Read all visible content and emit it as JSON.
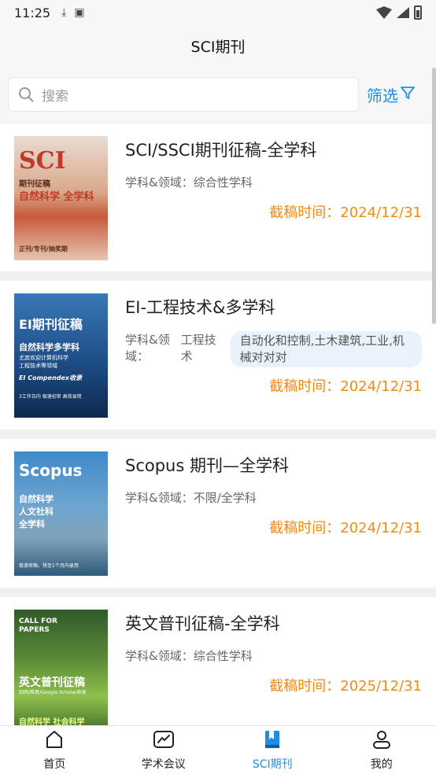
{
  "status": {
    "time": "11:25",
    "download_icon": "download-icon",
    "notification_icon": "a-icon"
  },
  "header": {
    "title": "SCI期刊"
  },
  "search": {
    "placeholder": "搜索",
    "filter_label": "筛选"
  },
  "journals": [
    {
      "title": "SCI/SSCI期刊征稿-全学科",
      "field_label": "学科&领域：",
      "field_value": "综合性学科",
      "tags": [],
      "deadline_label": "截稿时间：",
      "deadline": "2024/12/31",
      "cover_lines": [
        "SCI",
        "期刊征稿",
        "自然科学 全学科",
        "正刊/专刊/抽奖期"
      ]
    },
    {
      "title": "EI-工程技术&多学科",
      "field_label": "学科&领域：",
      "field_value": "工程技术",
      "tags": [
        "自动化和控制,土木建筑,工业,机械对对对"
      ],
      "deadline_label": "截稿时间：",
      "deadline": "2024/12/31",
      "cover_lines": [
        "EI期刊征稿",
        "自然科学多学科",
        "尤其欢迎计算机科学",
        "工程技术等领域",
        "EI Compendex收录",
        "3工作日内 极速初审 高效录用"
      ]
    },
    {
      "title": "Scopus 期刊—全学科",
      "field_label": "学科&领域：",
      "field_value": "不限/全学科",
      "tags": [],
      "deadline_label": "截稿时间：",
      "deadline": "2024/12/31",
      "cover_lines": [
        "Scopus",
        "自然科学",
        "人文社科",
        "全学科",
        "极速审稿，快至1个月内录用"
      ]
    },
    {
      "title": "英文普刊征稿-全学科",
      "field_label": "学科&领域：",
      "field_value": "综合性学科",
      "tags": [],
      "deadline_label": "截稿时间：",
      "deadline": "2025/12/31",
      "cover_lines": [
        "CALL FOR PAPERS",
        "英文普刊征稿",
        "知网/维普/Google Scholar收录",
        "自然科学 社会科学"
      ]
    }
  ],
  "tabs": [
    {
      "label": "首页",
      "icon": "home-icon"
    },
    {
      "label": "学术会议",
      "icon": "chart-icon"
    },
    {
      "label": "SCI期刊",
      "icon": "bookmark-icon",
      "active": true
    },
    {
      "label": "我的",
      "icon": "user-icon"
    }
  ],
  "colors": {
    "accent": "#1f8de0",
    "deadline": "#f08a18"
  }
}
